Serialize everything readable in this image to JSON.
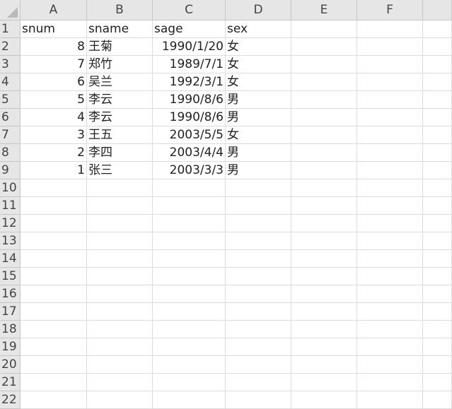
{
  "columns": [
    "A",
    "B",
    "C",
    "D",
    "E",
    "F",
    ""
  ],
  "rows": [
    "1",
    "2",
    "3",
    "4",
    "5",
    "6",
    "7",
    "8",
    "9",
    "10",
    "11",
    "12",
    "13",
    "14",
    "15",
    "16",
    "17",
    "18",
    "19",
    "20",
    "21",
    "22"
  ],
  "cells": [
    [
      "snum",
      "sname",
      "sage",
      "sex",
      "",
      "",
      ""
    ],
    [
      "8",
      "王菊",
      "1990/1/20",
      "女",
      "",
      "",
      ""
    ],
    [
      "7",
      "郑竹",
      "1989/7/1",
      "女",
      "",
      "",
      ""
    ],
    [
      "6",
      "吴兰",
      "1992/3/1",
      "女",
      "",
      "",
      ""
    ],
    [
      "5",
      "李云",
      "1990/8/6",
      "男",
      "",
      "",
      ""
    ],
    [
      "4",
      "李云",
      "1990/8/6",
      "男",
      "",
      "",
      ""
    ],
    [
      "3",
      "王五",
      "2003/5/5",
      "女",
      "",
      "",
      ""
    ],
    [
      "2",
      "李四",
      "2003/4/4",
      "男",
      "",
      "",
      ""
    ],
    [
      "1",
      "张三",
      "2003/3/3",
      "男",
      "",
      "",
      ""
    ],
    [
      "",
      "",
      "",
      "",
      "",
      "",
      ""
    ],
    [
      "",
      "",
      "",
      "",
      "",
      "",
      ""
    ],
    [
      "",
      "",
      "",
      "",
      "",
      "",
      ""
    ],
    [
      "",
      "",
      "",
      "",
      "",
      "",
      ""
    ],
    [
      "",
      "",
      "",
      "",
      "",
      "",
      ""
    ],
    [
      "",
      "",
      "",
      "",
      "",
      "",
      ""
    ],
    [
      "",
      "",
      "",
      "",
      "",
      "",
      ""
    ],
    [
      "",
      "",
      "",
      "",
      "",
      "",
      ""
    ],
    [
      "",
      "",
      "",
      "",
      "",
      "",
      ""
    ],
    [
      "",
      "",
      "",
      "",
      "",
      "",
      ""
    ],
    [
      "",
      "",
      "",
      "",
      "",
      "",
      ""
    ],
    [
      "",
      "",
      "",
      "",
      "",
      "",
      ""
    ],
    [
      "",
      "",
      "",
      "",
      "",
      "",
      ""
    ]
  ]
}
